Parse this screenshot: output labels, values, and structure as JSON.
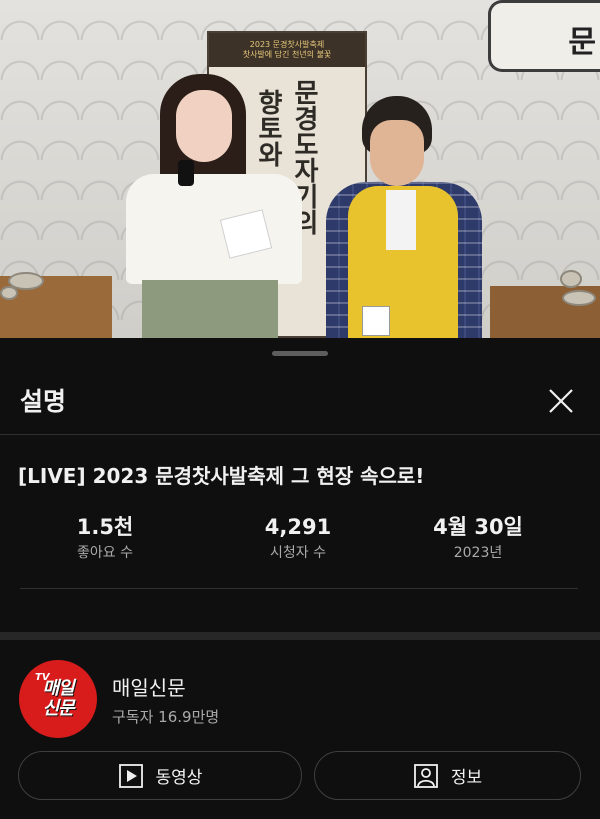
{
  "video": {
    "banner_line1": "2023 문경찻사발축제",
    "banner_line2": "찻사발에 담긴 천년의 불꽃",
    "banner_vertical_right": "문경도자기의",
    "banner_vertical_left": "향토와 정취",
    "corner_char": "문"
  },
  "panel": {
    "title": "설명",
    "close_icon": "close-icon"
  },
  "video_info": {
    "title": "[LIVE] 2023 문경찻사발축제 그 현장 속으로!",
    "stats": [
      {
        "value": "1.5천",
        "label": "좋아요 수"
      },
      {
        "value": "4,291",
        "label": "시청자 수"
      },
      {
        "value": "4월 30일",
        "label": "2023년"
      }
    ]
  },
  "channel": {
    "logo_tv": "TV",
    "logo_line1": "매일",
    "logo_line2": "신문",
    "name": "매일신문",
    "subscribers": "구독자 16.9만명"
  },
  "buttons": {
    "videos_label": "동영상",
    "videos_icon": "play-box-icon",
    "about_label": "정보",
    "about_icon": "person-box-icon"
  },
  "colors": {
    "background": "#0f0f0f",
    "text_primary": "#f1f1f1",
    "text_secondary": "#aaaaaa",
    "channel_red": "#d81b1b"
  }
}
